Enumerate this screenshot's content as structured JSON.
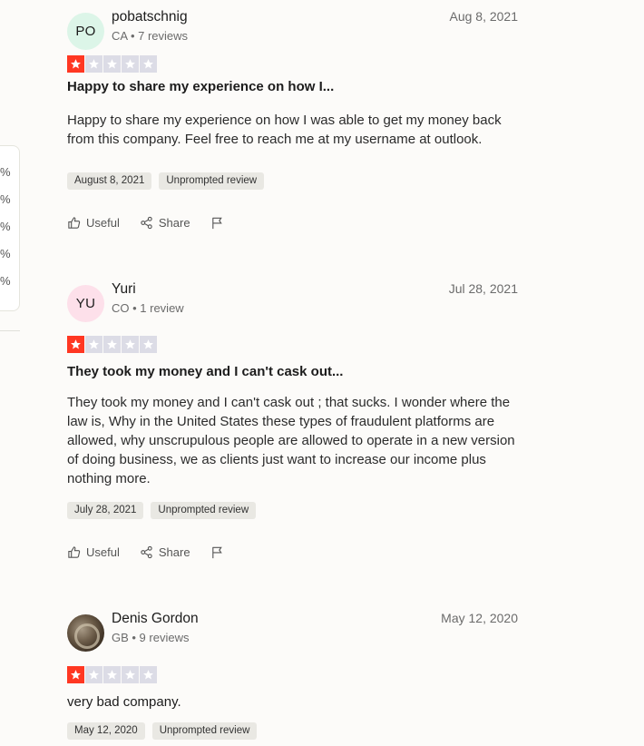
{
  "sidebar": {
    "percent_items": [
      "%",
      "%",
      "%",
      "%",
      "%"
    ]
  },
  "reviews": [
    {
      "initials": "PO",
      "name": "pobatschnig",
      "meta": "CA • 7 reviews",
      "date": "Aug 8, 2021",
      "rating": 1,
      "title": "Happy to share my experience on how I...",
      "body": "Happy to share my experience on how I was able to get my money back from this company. Feel free to reach me at my username at outlook.",
      "experience_date": "August 8, 2021",
      "tag": "Unprompted review",
      "useful_label": "Useful",
      "share_label": "Share"
    },
    {
      "initials": "YU",
      "name": "Yuri",
      "meta": "CO • 1 review",
      "date": "Jul 28, 2021",
      "rating": 1,
      "title": "They took my money and I can't cask out...",
      "body": "They took my money and I can't cask out ; that sucks. I wonder where the law is, Why in the United States these types of fraudulent platforms are allowed, why unscrupulous people are allowed to operate in a new version of doing business, we as clients just want to increase our income plus nothing more.",
      "experience_date": "July 28, 2021",
      "tag": "Unprompted review",
      "useful_label": "Useful",
      "share_label": "Share"
    },
    {
      "initials": "",
      "name": "Denis Gordon",
      "meta": "GB • 9 reviews",
      "date": "May 12, 2020",
      "rating": 1,
      "title": "very bad company.",
      "body": "",
      "experience_date": "May 12, 2020",
      "tag": "Unprompted review"
    }
  ],
  "colors": {
    "star_on": "#ff3722",
    "star_off": "#dcdce6"
  }
}
